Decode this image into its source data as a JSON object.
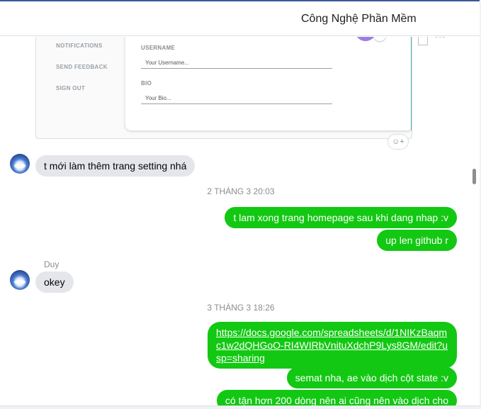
{
  "header": {
    "title": "Công Nghệ Phần Mềm"
  },
  "shared_image": {
    "nav_items": [
      "NOTIFICATIONS",
      "SEND FEEDBACK",
      "SIGN OUT"
    ],
    "fields": [
      {
        "label": "USERNAME",
        "placeholder": "Your Username..."
      },
      {
        "label": "BIO",
        "placeholder": "Your Bio..."
      }
    ]
  },
  "icons": {
    "more": "•••",
    "emoji_react": "☺+",
    "edit": "✎"
  },
  "messages": [
    {
      "type": "in",
      "text": "t mới làm thêm trang setting nhá"
    },
    {
      "type": "time",
      "text": "2 THÁNG 3 20:03"
    },
    {
      "type": "out",
      "text": "t lam xong trang homepage sau khi dang nhap :v"
    },
    {
      "type": "out",
      "text": "up len github r"
    },
    {
      "type": "sender",
      "text": "Duy"
    },
    {
      "type": "in",
      "text": "okey"
    },
    {
      "type": "time",
      "text": "3 THÁNG 3 18:26"
    },
    {
      "type": "out_link",
      "text": "https://docs.google.com/spreadsheets/d/1NIKzBaqmc1w2dQHGoO-RI4WIRbVnituXdchP9Lys8GM/edit?usp=sharing"
    },
    {
      "type": "out",
      "text": "semat nha, ae vào dịch cột state :v"
    },
    {
      "type": "out",
      "text": "có tận hơn 200 dòng nên ai cũng nên vào dịch cho"
    }
  ],
  "colors": {
    "outgoing_bubble": "#12c812",
    "incoming_bubble": "#e4e6eb",
    "header_accent": "#3b5998"
  }
}
